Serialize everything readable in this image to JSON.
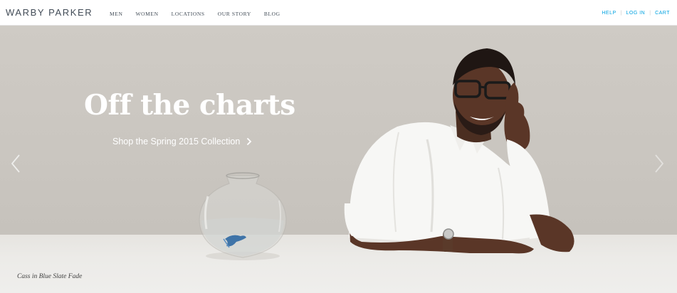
{
  "brand": {
    "logo_text": "WARBY PARKER"
  },
  "nav": {
    "items": [
      {
        "label": "MEN"
      },
      {
        "label": "WOMEN"
      },
      {
        "label": "LOCATIONS"
      },
      {
        "label": "OUR STORY"
      },
      {
        "label": "BLOG"
      }
    ]
  },
  "utility": {
    "help": "HELP",
    "login": "LOG IN",
    "cart": "CART",
    "separator": "|",
    "color": "#00a2e1"
  },
  "hero": {
    "headline": "Off the charts",
    "cta_label": "Shop the Spring 2015 Collection",
    "cta_icon": "chevron-right-icon",
    "prev_icon": "chevron-left-icon",
    "next_icon": "chevron-right-icon",
    "caption": "Cass in Blue Slate Fade"
  }
}
